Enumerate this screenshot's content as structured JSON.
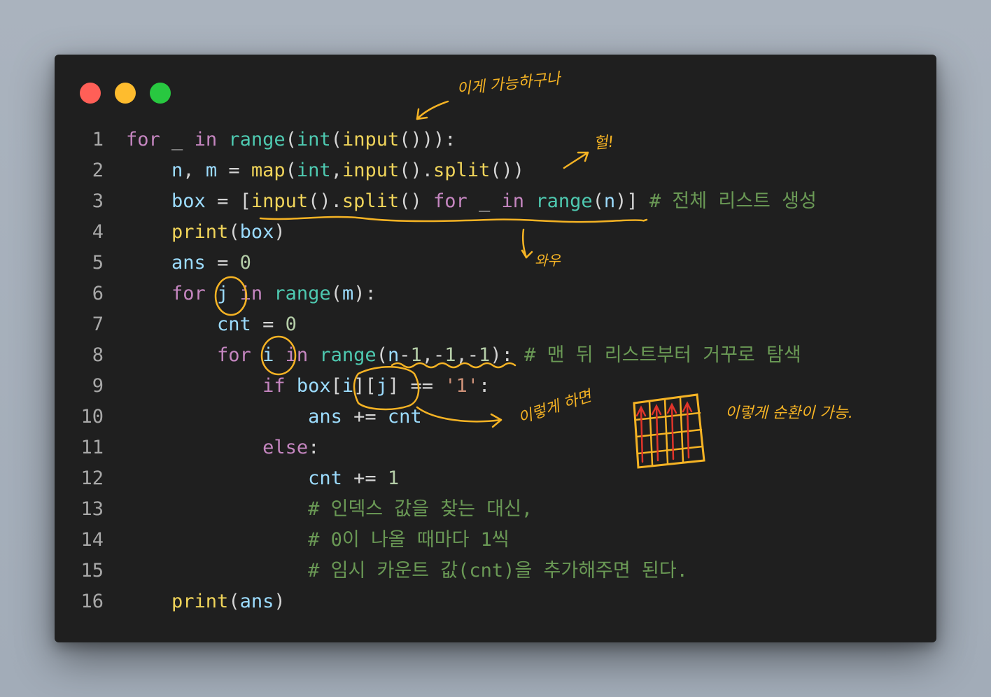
{
  "window": {
    "buttons": [
      "close",
      "minimize",
      "maximize"
    ]
  },
  "code": {
    "lines": [
      {
        "n": "1",
        "tokens": [
          {
            "t": "for",
            "c": "kw"
          },
          {
            "t": " _ ",
            "c": "pun"
          },
          {
            "t": "in",
            "c": "kw"
          },
          {
            "t": " ",
            "c": "pun"
          },
          {
            "t": "range",
            "c": "fn"
          },
          {
            "t": "(",
            "c": "pun"
          },
          {
            "t": "int",
            "c": "fn"
          },
          {
            "t": "(",
            "c": "pun"
          },
          {
            "t": "input",
            "c": "yl"
          },
          {
            "t": "())):",
            "c": "pun"
          }
        ]
      },
      {
        "n": "2",
        "tokens": [
          {
            "t": "    ",
            "c": "pun"
          },
          {
            "t": "n",
            "c": "var"
          },
          {
            "t": ", ",
            "c": "pun"
          },
          {
            "t": "m",
            "c": "var"
          },
          {
            "t": " = ",
            "c": "pun"
          },
          {
            "t": "map",
            "c": "yl"
          },
          {
            "t": "(",
            "c": "pun"
          },
          {
            "t": "int",
            "c": "fn"
          },
          {
            "t": ",",
            "c": "pun"
          },
          {
            "t": "input",
            "c": "yl"
          },
          {
            "t": "().",
            "c": "pun"
          },
          {
            "t": "split",
            "c": "yl"
          },
          {
            "t": "())",
            "c": "pun"
          }
        ]
      },
      {
        "n": "3",
        "tokens": [
          {
            "t": "    ",
            "c": "pun"
          },
          {
            "t": "box",
            "c": "var"
          },
          {
            "t": " = [",
            "c": "pun"
          },
          {
            "t": "input",
            "c": "yl"
          },
          {
            "t": "().",
            "c": "pun"
          },
          {
            "t": "split",
            "c": "yl"
          },
          {
            "t": "() ",
            "c": "pun"
          },
          {
            "t": "for",
            "c": "kw"
          },
          {
            "t": " _ ",
            "c": "pun"
          },
          {
            "t": "in",
            "c": "kw"
          },
          {
            "t": " ",
            "c": "pun"
          },
          {
            "t": "range",
            "c": "fn"
          },
          {
            "t": "(",
            "c": "pun"
          },
          {
            "t": "n",
            "c": "var"
          },
          {
            "t": ")] ",
            "c": "pun"
          },
          {
            "t": "# 전체 리스트 생성",
            "c": "cm"
          }
        ]
      },
      {
        "n": "4",
        "tokens": [
          {
            "t": "    ",
            "c": "pun"
          },
          {
            "t": "print",
            "c": "yl"
          },
          {
            "t": "(",
            "c": "pun"
          },
          {
            "t": "box",
            "c": "var"
          },
          {
            "t": ")",
            "c": "pun"
          }
        ]
      },
      {
        "n": "5",
        "tokens": [
          {
            "t": "    ",
            "c": "pun"
          },
          {
            "t": "ans",
            "c": "var"
          },
          {
            "t": " = ",
            "c": "pun"
          },
          {
            "t": "0",
            "c": "num"
          }
        ]
      },
      {
        "n": "6",
        "tokens": [
          {
            "t": "    ",
            "c": "pun"
          },
          {
            "t": "for",
            "c": "kw"
          },
          {
            "t": " ",
            "c": "pun"
          },
          {
            "t": "j",
            "c": "var"
          },
          {
            "t": " ",
            "c": "pun"
          },
          {
            "t": "in",
            "c": "kw"
          },
          {
            "t": " ",
            "c": "pun"
          },
          {
            "t": "range",
            "c": "fn"
          },
          {
            "t": "(",
            "c": "pun"
          },
          {
            "t": "m",
            "c": "var"
          },
          {
            "t": "):",
            "c": "pun"
          }
        ]
      },
      {
        "n": "7",
        "tokens": [
          {
            "t": "        ",
            "c": "pun"
          },
          {
            "t": "cnt",
            "c": "var"
          },
          {
            "t": " = ",
            "c": "pun"
          },
          {
            "t": "0",
            "c": "num"
          }
        ]
      },
      {
        "n": "8",
        "tokens": [
          {
            "t": "        ",
            "c": "pun"
          },
          {
            "t": "for",
            "c": "kw"
          },
          {
            "t": " ",
            "c": "pun"
          },
          {
            "t": "i",
            "c": "var"
          },
          {
            "t": " ",
            "c": "pun"
          },
          {
            "t": "in",
            "c": "kw"
          },
          {
            "t": " ",
            "c": "pun"
          },
          {
            "t": "range",
            "c": "fn"
          },
          {
            "t": "(",
            "c": "pun"
          },
          {
            "t": "n",
            "c": "var"
          },
          {
            "t": "-",
            "c": "pun"
          },
          {
            "t": "1",
            "c": "num"
          },
          {
            "t": ",-",
            "c": "pun"
          },
          {
            "t": "1",
            "c": "num"
          },
          {
            "t": ",-",
            "c": "pun"
          },
          {
            "t": "1",
            "c": "num"
          },
          {
            "t": "): ",
            "c": "pun"
          },
          {
            "t": "# 맨 뒤 리스트부터 거꾸로 탐색",
            "c": "cm"
          }
        ]
      },
      {
        "n": "9",
        "tokens": [
          {
            "t": "            ",
            "c": "pun"
          },
          {
            "t": "if",
            "c": "kw"
          },
          {
            "t": " ",
            "c": "pun"
          },
          {
            "t": "box",
            "c": "var"
          },
          {
            "t": "[",
            "c": "pun"
          },
          {
            "t": "i",
            "c": "var"
          },
          {
            "t": "][",
            "c": "pun"
          },
          {
            "t": "j",
            "c": "var"
          },
          {
            "t": "] == ",
            "c": "pun"
          },
          {
            "t": "'1'",
            "c": "str"
          },
          {
            "t": ":",
            "c": "pun"
          }
        ]
      },
      {
        "n": "10",
        "tokens": [
          {
            "t": "                ",
            "c": "pun"
          },
          {
            "t": "ans",
            "c": "var"
          },
          {
            "t": " += ",
            "c": "pun"
          },
          {
            "t": "cnt",
            "c": "var"
          }
        ]
      },
      {
        "n": "11",
        "tokens": [
          {
            "t": "            ",
            "c": "pun"
          },
          {
            "t": "else",
            "c": "kw"
          },
          {
            "t": ":",
            "c": "pun"
          }
        ]
      },
      {
        "n": "12",
        "tokens": [
          {
            "t": "                ",
            "c": "pun"
          },
          {
            "t": "cnt",
            "c": "var"
          },
          {
            "t": " += ",
            "c": "pun"
          },
          {
            "t": "1",
            "c": "num"
          }
        ]
      },
      {
        "n": "13",
        "tokens": [
          {
            "t": "                ",
            "c": "pun"
          },
          {
            "t": "# 인덱스 값을 찾는 대신,",
            "c": "cm"
          }
        ]
      },
      {
        "n": "14",
        "tokens": [
          {
            "t": "                ",
            "c": "pun"
          },
          {
            "t": "# 0이 나올 때마다 1씩",
            "c": "cm"
          }
        ]
      },
      {
        "n": "15",
        "tokens": [
          {
            "t": "                ",
            "c": "pun"
          },
          {
            "t": "# 임시 카운트 값(cnt)을 추가해주면 된다.",
            "c": "cm"
          }
        ]
      },
      {
        "n": "16",
        "tokens": [
          {
            "t": "    ",
            "c": "pun"
          },
          {
            "t": "print",
            "c": "yl"
          },
          {
            "t": "(",
            "c": "pun"
          },
          {
            "t": "ans",
            "c": "var"
          },
          {
            "t": ")",
            "c": "pun"
          }
        ]
      }
    ]
  },
  "annotations": {
    "possible": "이게 가능하구나",
    "wow1": "헐!",
    "wow2": "와우",
    "if_done": "이렇게 하면",
    "traverse": "이렇게 순환이 가능."
  },
  "colors": {
    "kw": "#c586c0",
    "fn": "#4ec9b0",
    "var": "#9cdcfe",
    "num": "#b5cea8",
    "str": "#ce9178",
    "cm": "#6a9955",
    "ink": "#f5b324",
    "grid_arrow": "#e0342a"
  }
}
